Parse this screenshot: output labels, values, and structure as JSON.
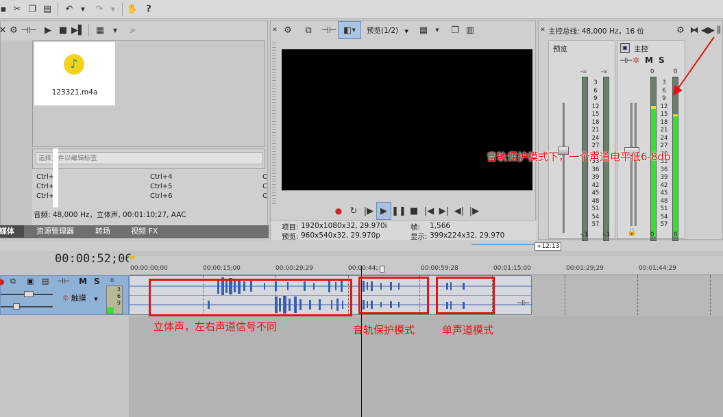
{
  "media_panel": {
    "file_name": "123321.m4a",
    "search_placeholder": "选择文件以编辑标签",
    "shortcuts": [
      {
        "left": "Ctrl+",
        "mid": "Ctrl+4",
        "right": "C"
      },
      {
        "left": "Ctrl+",
        "mid": "Ctrl+5",
        "right": "C"
      },
      {
        "left": "Ctrl+",
        "mid": "Ctrl+6",
        "right": "C"
      }
    ],
    "info": "音频: 48,000 Hz，立体声, 00:01:10;27, AAC",
    "tabs": [
      "媒体",
      "资源管理器",
      "转场",
      "视频 FX"
    ]
  },
  "preview_panel": {
    "mode_label": "预览(1/2)",
    "project_label": "项目:",
    "project_value": "1920x1080x32, 29.970i",
    "preview_label": "预览:",
    "preview_value": "960x540x32, 29.970p",
    "frame_label": "帧:",
    "frame_value": "1,566",
    "display_label": "显示:",
    "display_value": "399x224x32, 29.970"
  },
  "master_panel": {
    "title": "主控总线: 48,000 Hz，16 位",
    "preview_label": "预览",
    "master_label": "主控",
    "m_label": "M",
    "s_label": "S",
    "neg_inf": "-∞",
    "zero": "0",
    "scale": [
      "3",
      "6",
      "9",
      "12",
      "15",
      "18",
      "21",
      "24",
      "27",
      "30",
      "33",
      "36",
      "39",
      "42",
      "45",
      "48",
      "51",
      "54",
      "57"
    ],
    "bottom_left": "-.1",
    "bottom_right": "-.1",
    "bottom_zero_a": "0",
    "bottom_zero_b": "0",
    "master_level_left": 0.82,
    "master_level_right": 0.77
  },
  "timeline": {
    "timecode": "00:00:52;06",
    "marker": "+12:13",
    "ruler": [
      "00:00:00;00",
      "00:00:15;00",
      "00:00:29;29",
      "00:00:44;",
      "00:00:59;28",
      "00:01:15;00",
      "00:01:29;29",
      "00:01:44;29"
    ],
    "track": {
      "m_label": "M",
      "s_label": "S",
      "mode_label": "触摸",
      "meter_top": "0",
      "meter_3": "3",
      "meter_6": "6",
      "meter_9": "9"
    }
  },
  "annotations": {
    "mono_drop": "音轨保护模式下，一个声道电平低6-8db",
    "stereo": "立体声，左右声道信号不同",
    "protect": "音轨保护模式",
    "mono": "单声道模式"
  },
  "colors": {
    "annotation": "#e01515",
    "meter_green": "#33e033",
    "track_blue": "#8fb1d6",
    "waveform": "#3b5fa8"
  }
}
